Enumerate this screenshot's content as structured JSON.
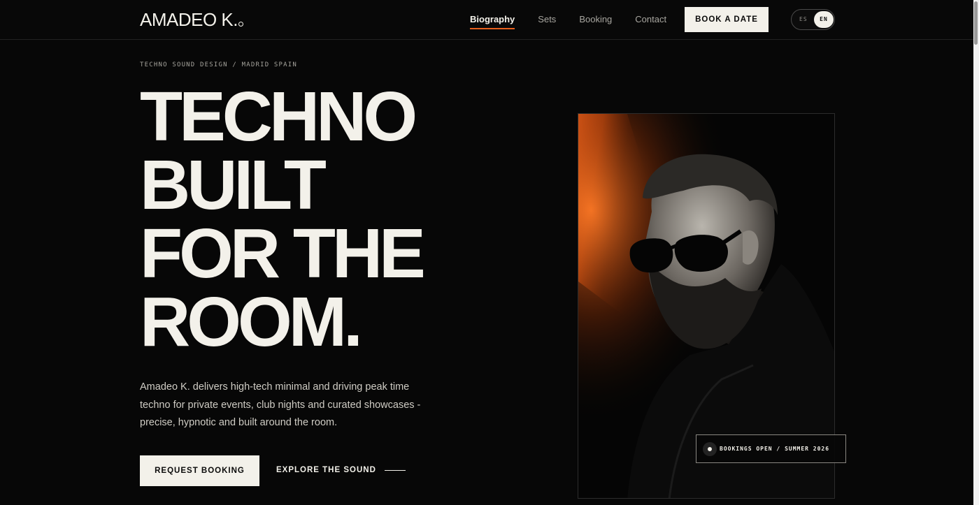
{
  "header": {
    "logo": "AMADEO K.",
    "nav": [
      {
        "label": "Biography",
        "active": true
      },
      {
        "label": "Sets",
        "active": false
      },
      {
        "label": "Booking",
        "active": false
      },
      {
        "label": "Contact",
        "active": false
      }
    ],
    "cta_label": "BOOK A DATE",
    "lang": {
      "es": "ES",
      "en": "EN",
      "selected": "EN"
    }
  },
  "hero": {
    "eyebrow": "TECHNO SOUND DESIGN / MADRID SPAIN",
    "headline": [
      "TECHNO",
      "BUILT",
      "FOR THE",
      "ROOM."
    ],
    "description": "Amadeo K. delivers high-tech minimal and driving peak time techno for private events, club nights and curated showcases - precise, hypnotic and built around the room.",
    "primary_cta": "REQUEST BOOKING",
    "secondary_cta": "EXPLORE THE SOUND"
  },
  "portrait": {
    "badge": "BOOKINGS OPEN / SUMMER 2026",
    "accent_color": "#e8601c"
  },
  "colors": {
    "background": "#070707",
    "text": "#f3f1ea",
    "accent": "#e8601c"
  }
}
